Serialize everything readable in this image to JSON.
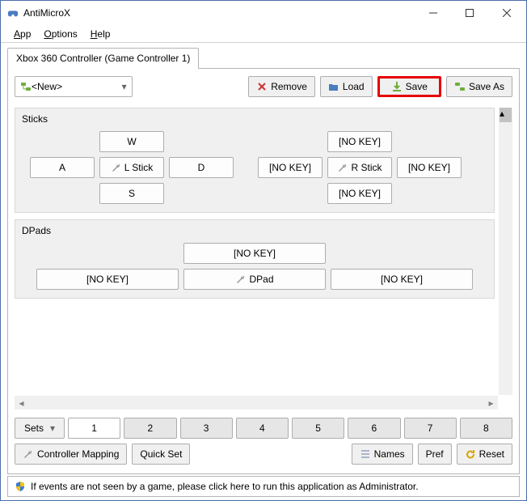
{
  "window": {
    "title": "AntiMicroX"
  },
  "menu": {
    "app": "App",
    "options": "Options",
    "help": "Help"
  },
  "tab": {
    "label": "Xbox 360 Controller (Game Controller 1)"
  },
  "profile": {
    "selected": "<New>",
    "remove": "Remove",
    "load": "Load",
    "save": "Save",
    "saveas": "Save As"
  },
  "groups": {
    "sticks": {
      "title": "Sticks",
      "left": {
        "up": "W",
        "left": "A",
        "center": "L Stick",
        "right": "D",
        "down": "S"
      },
      "right": {
        "up": "[NO KEY]",
        "left": "[NO KEY]",
        "center": "R Stick",
        "right": "[NO KEY]",
        "down": "[NO KEY]"
      }
    },
    "dpads": {
      "title": "DPads",
      "up": "[NO KEY]",
      "left": "[NO KEY]",
      "center": "DPad",
      "right": "[NO KEY]"
    }
  },
  "sets": {
    "label": "Sets",
    "values": [
      "1",
      "2",
      "3",
      "4",
      "5",
      "6",
      "7",
      "8"
    ],
    "active": 0
  },
  "bottom": {
    "mapping": "Controller Mapping",
    "quickset": "Quick Set",
    "names": "Names",
    "pref": "Pref",
    "reset": "Reset"
  },
  "status": {
    "text": "If events are not seen by a game, please click here to run this application as Administrator."
  }
}
